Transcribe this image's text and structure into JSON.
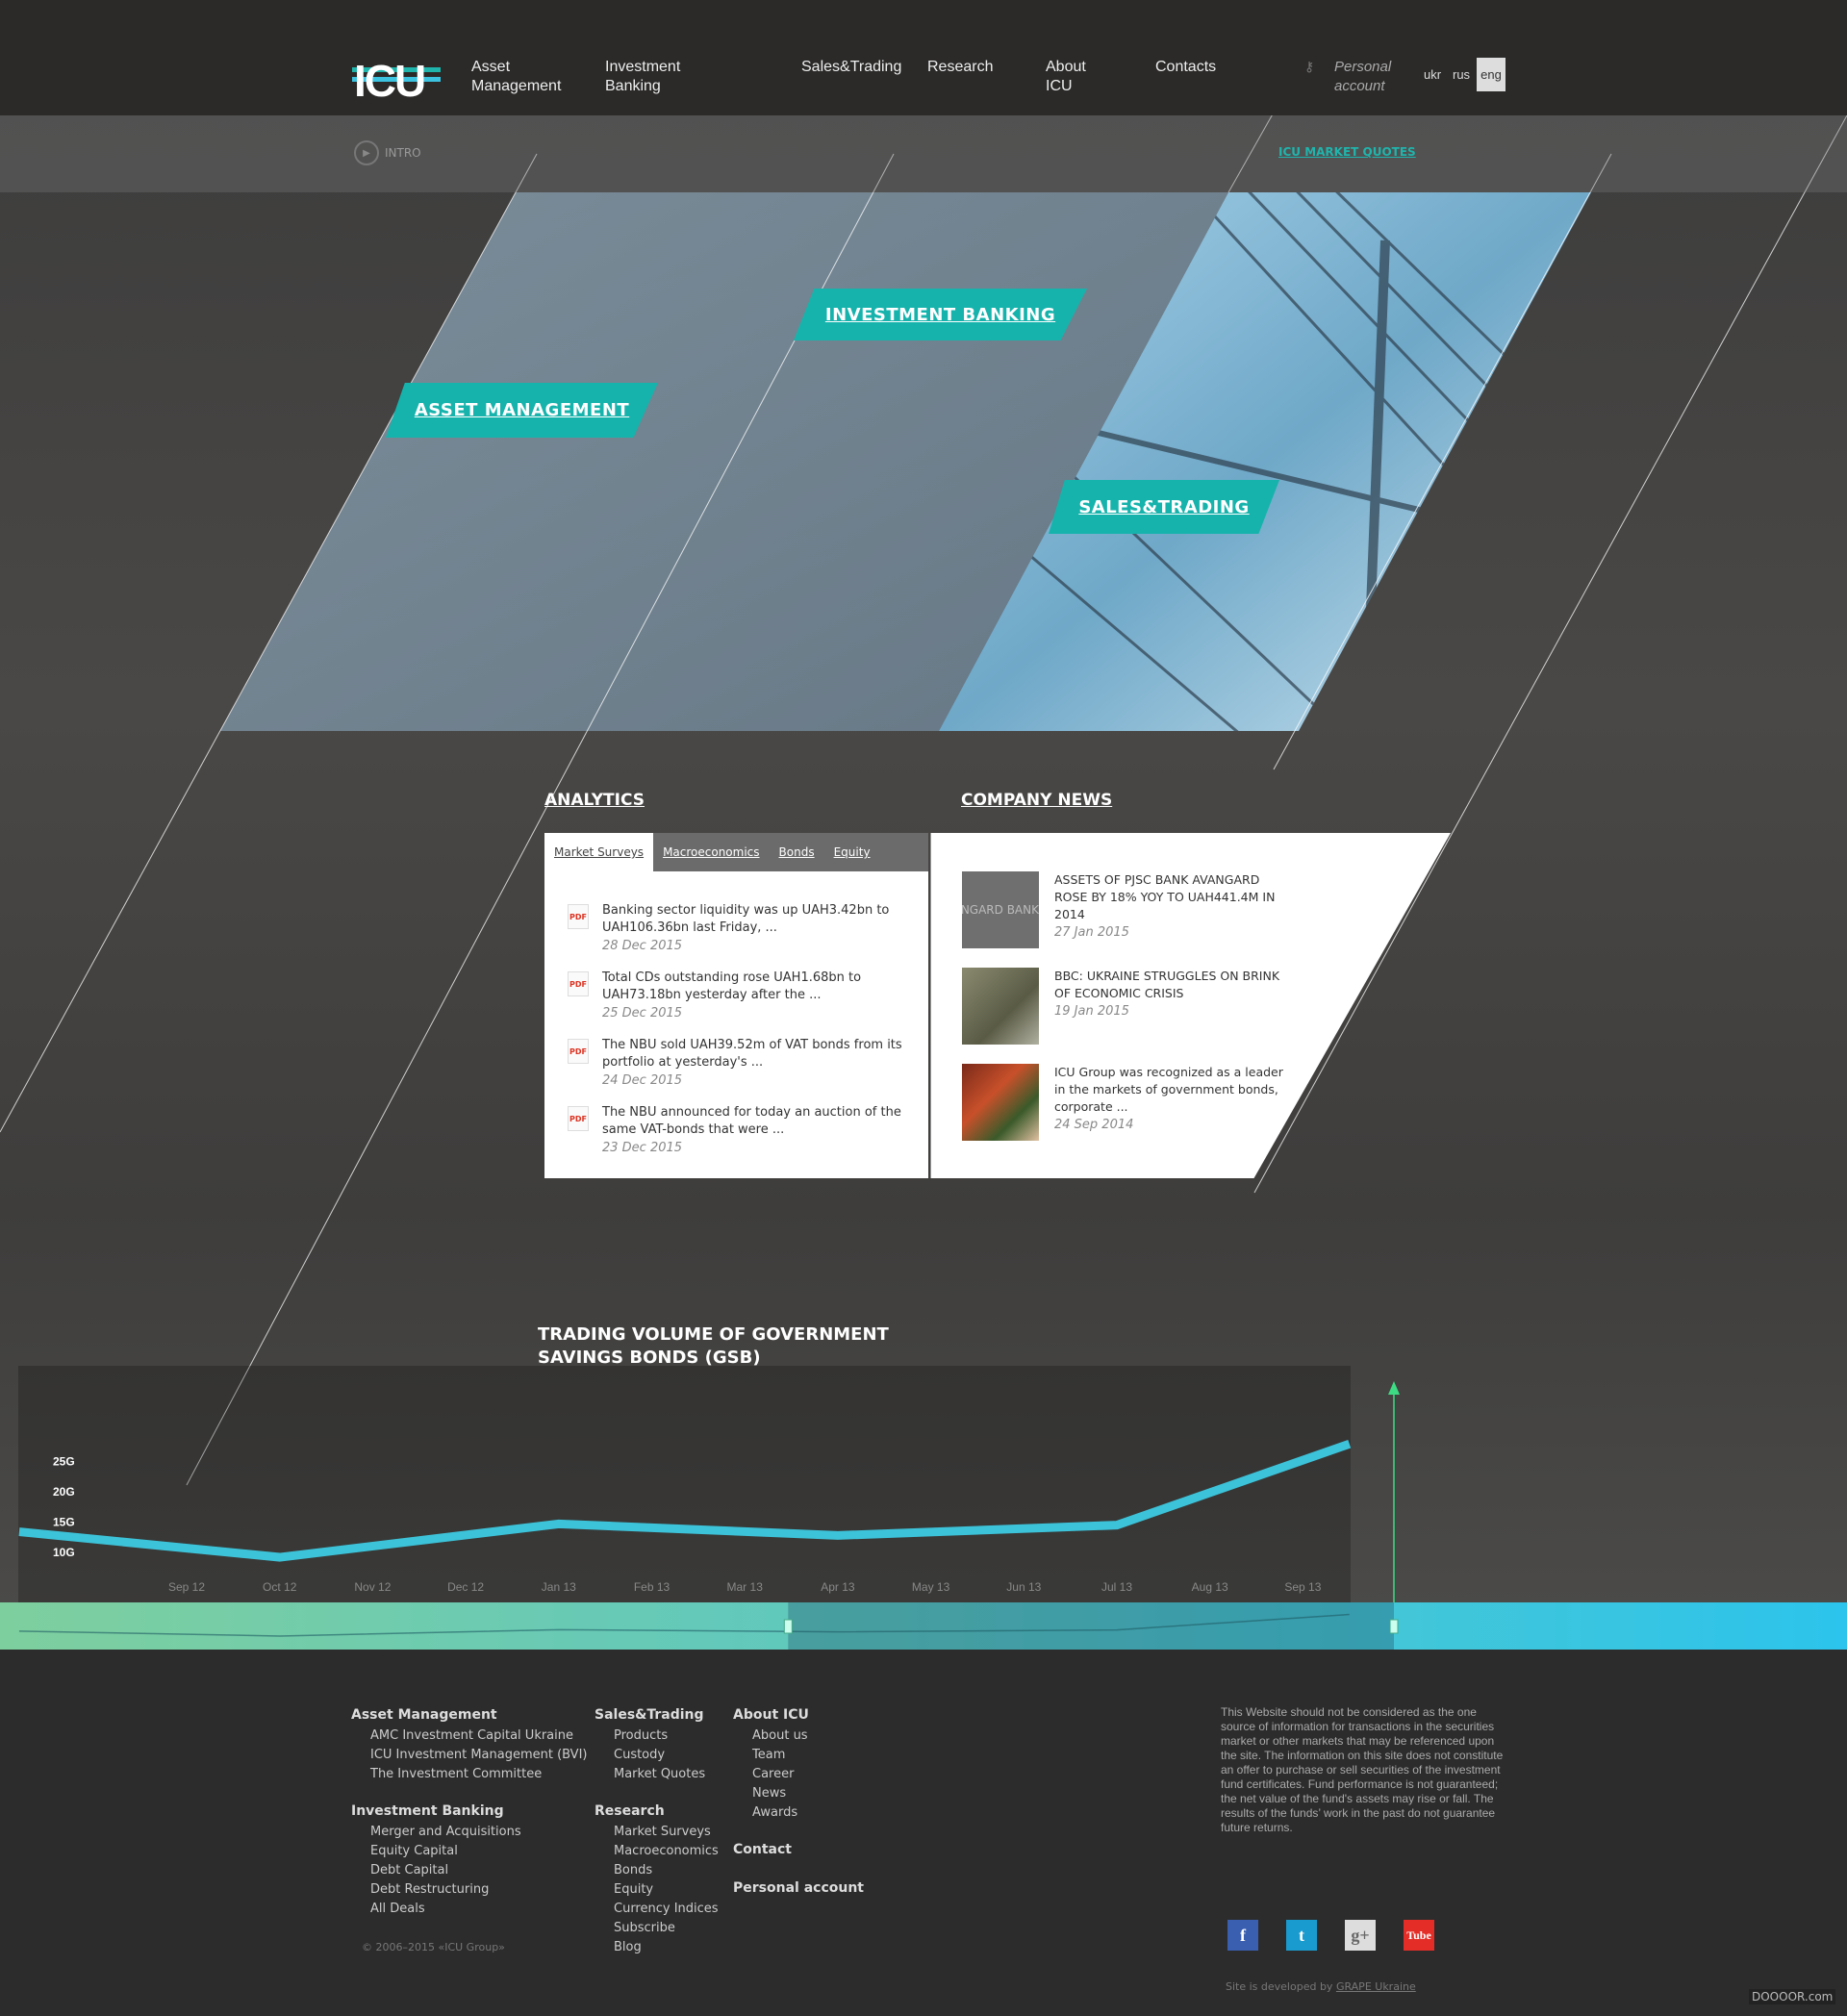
{
  "header": {
    "logo": "ICU",
    "nav": [
      {
        "label": "Asset\nManagement"
      },
      {
        "label": "Investment\nBanking"
      },
      {
        "label": "Sales&Trading"
      },
      {
        "label": "Research"
      },
      {
        "label": "About\nICU"
      },
      {
        "label": "Contacts"
      }
    ],
    "personal_account": "Personal\naccount",
    "languages": [
      "ukr",
      "rus",
      "eng"
    ],
    "active_language": "eng"
  },
  "subbar": {
    "intro": "INTRO",
    "market_quotes": "ICU MARKET QUOTES"
  },
  "hero": {
    "asset_management": "ASSET MANAGEMENT",
    "investment_banking": "INVESTMENT BANKING",
    "sales_trading": "SALES&TRADING"
  },
  "colors": {
    "accent": "#16b3ac",
    "header_bg": "#2b2a29",
    "chart_line": "#3cc3d9",
    "marker": "#3ddc84"
  },
  "analytics": {
    "title": "ANALYTICS",
    "tabs": [
      "Market Surveys",
      "Macroeconomics",
      "Bonds",
      "Equity"
    ],
    "active_tab": "Market Surveys",
    "items": [
      {
        "icon": "PDF",
        "text": "Banking sector liquidity was up UAH3.42bn to UAH106.36bn last Friday, ...",
        "date": "28 Dec 2015"
      },
      {
        "icon": "PDF",
        "text": "Total CDs outstanding rose UAH1.68bn to UAH73.18bn yesterday after the ...",
        "date": "25 Dec 2015"
      },
      {
        "icon": "PDF",
        "text": "The NBU sold UAH39.52m of VAT bonds from its portfolio at yesterday's ...",
        "date": "24 Dec 2015"
      },
      {
        "icon": "PDF",
        "text": "The NBU announced for today an auction of the same VAT-bonds that were ...",
        "date": "23 Dec 2015"
      }
    ]
  },
  "news": {
    "title": "COMPANY NEWS",
    "items": [
      {
        "thumb_text": "AVANGARD BANK",
        "text": "ASSETS OF PJSC BANK AVANGARD ROSE BY 18% YOY TO UAH441.4M IN 2014",
        "date": "27 Jan 2015"
      },
      {
        "thumb_text": "",
        "text": "BBC: UKRAINE STRUGGLES ON BRINK OF ECONOMIC CRISIS",
        "date": "19 Jan 2015"
      },
      {
        "thumb_text": "",
        "text": "ICU Group was recognized as a leader in the markets of government bonds, corporate ...",
        "date": "24 Sep 2014"
      }
    ]
  },
  "chart_data": {
    "type": "line",
    "title": "TRADING VOLUME OF GOVERNMENT SAVINGS BONDS (GSB)",
    "y_ticks": [
      "25G",
      "20G",
      "15G",
      "10G"
    ],
    "y_tick_values": [
      25,
      20,
      15,
      10
    ],
    "x_ticks": [
      "Sep 12",
      "Oct 12",
      "Nov 12",
      "Dec 12",
      "Jan 13",
      "Feb 13",
      "Mar 13",
      "Apr 13",
      "May 13",
      "Jun 13",
      "Jul 13",
      "Aug 13",
      "Sep 13"
    ],
    "series": [
      {
        "points": [
          {
            "x": "2012-07-07",
            "y": 13.4
          },
          {
            "x": "2012-10-01",
            "y": 9.2
          },
          {
            "x": "2013-01-01",
            "y": 14.7
          },
          {
            "x": "2013-04-01",
            "y": 12.8
          },
          {
            "x": "2013-07-01",
            "y": 14.5
          },
          {
            "x": "2013-09-16",
            "y": 27.9
          }
        ]
      }
    ],
    "ylim": [
      5,
      30
    ],
    "navigator_range": [
      "2013-03-15",
      "2013-09-16"
    ],
    "grid": false
  },
  "footer": {
    "columns": [
      {
        "groups": [
          {
            "title": "Asset Management",
            "links": [
              "AMC Investment Capital Ukraine",
              "ICU Investment Management (BVI)",
              "The Investment Committee"
            ]
          },
          {
            "title": "Investment Banking",
            "links": [
              "Merger and Acquisitions",
              "Equity Capital",
              "Debt Capital",
              "Debt Restructuring",
              "All Deals"
            ]
          }
        ]
      },
      {
        "groups": [
          {
            "title": "Sales&Trading",
            "links": [
              "Products",
              "Custody",
              "Market Quotes"
            ]
          },
          {
            "title": "Research",
            "links": [
              "Market Surveys",
              "Macroeconomics",
              "Bonds",
              "Equity",
              "Currency Indices",
              "Subscribe",
              "Blog"
            ]
          }
        ]
      },
      {
        "groups": [
          {
            "title": "About ICU",
            "links": [
              "About us",
              "Team",
              "Career",
              "News",
              "Awards"
            ]
          },
          {
            "title": "Contact",
            "links": []
          },
          {
            "title": "Personal account",
            "links": []
          }
        ]
      }
    ],
    "copyright": "© 2006–2015 «ICU Group»",
    "disclaimer": "This Website should not be considered as the one source of information for transactions in the securities market or other markets that may be referenced upon the site. The information on this site does not constitute an offer to purchase or sell securities of the investment fund certificates. Fund performance is not guaranteed; the net value of the fund's assets may rise or fall. The results of the funds’ work in the past do not guarantee future returns.",
    "social": [
      {
        "name": "facebook-icon",
        "glyph": "f",
        "color": "#3a5fb0"
      },
      {
        "name": "twitter-icon",
        "glyph": "t",
        "color": "#1a9bd0"
      },
      {
        "name": "google-plus-icon",
        "glyph": "g+",
        "color": "#dddddd"
      },
      {
        "name": "youtube-icon",
        "glyph": "Tube",
        "color": "#e52d27"
      }
    ],
    "developed_by": "Site is developed by ",
    "developer": "GRAPE Ukraine",
    "watermark": "DOOOOR.com"
  }
}
